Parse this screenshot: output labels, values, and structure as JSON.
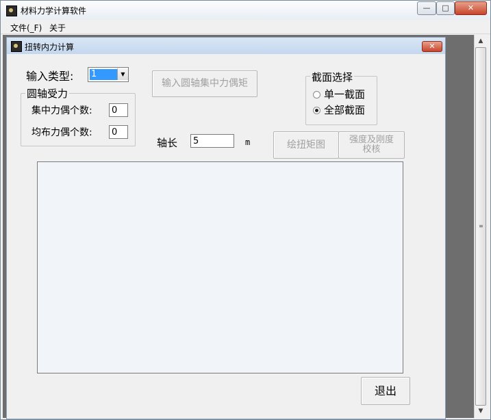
{
  "window": {
    "title": "材料力学计算软件",
    "minimize_glyph": "—",
    "maximize_glyph": "□",
    "close_glyph": "✕"
  },
  "menu": {
    "file": "文件(_F)",
    "about": "关于"
  },
  "child": {
    "title": "扭转内力计算",
    "close_glyph": "✕",
    "input_type_label": "输入类型:",
    "input_type_value": "1",
    "shaft_group": {
      "legend": "圆轴受力",
      "concentrated_label": "集中力偶个数:",
      "concentrated_value": "0",
      "distributed_label": "均布力偶个数:",
      "distributed_value": "0"
    },
    "input_couple_button": "输入圆轴集中力偶矩",
    "section_group": {
      "legend": "截面选择",
      "single": "单一截面",
      "all": "全部截面",
      "selected": "all"
    },
    "length_label": "轴长",
    "length_value": "5",
    "length_unit": "m",
    "draw_button": "绘扭矩图",
    "check_button_line1": "强度及刚度",
    "check_button_line2": "校核",
    "exit_button": "退出"
  },
  "icons": {
    "app": "app-icon",
    "child": "child-window-icon",
    "dropdown": "chevron-down-icon"
  }
}
